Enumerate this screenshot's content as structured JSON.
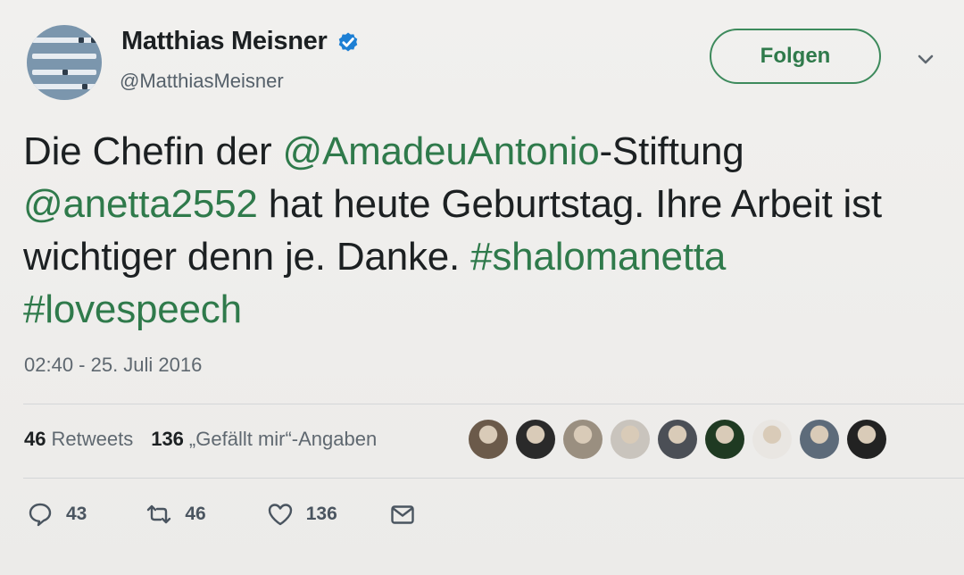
{
  "author": {
    "name": "Matthias Meisner",
    "handle": "@MatthiasMeisner",
    "verified": true
  },
  "follow_button": {
    "label": "Folgen"
  },
  "tweet": {
    "text_segments": [
      {
        "text": "Die Chefin der ",
        "link": false
      },
      {
        "text": "@AmadeuAntonio",
        "link": true
      },
      {
        "text": "-Stiftung ",
        "link": false
      },
      {
        "text": "@anetta2552",
        "link": true
      },
      {
        "text": " hat heute Geburtstag. Ihre Arbeit ist wichtiger denn je. Danke. ",
        "link": false
      },
      {
        "text": "#shalomanetta",
        "link": true
      },
      {
        "text": " ",
        "link": false
      },
      {
        "text": "#lovespeech",
        "link": true
      }
    ],
    "timestamp": "02:40 - 25. Juli 2016"
  },
  "stats": {
    "retweets_count": "46",
    "retweets_label": "Retweets",
    "likes_count": "136",
    "likes_label": "„Gefällt mir“-Angaben"
  },
  "likers": [
    {
      "name": "liker-avatar-1",
      "color": "#6b5a4a"
    },
    {
      "name": "liker-avatar-2",
      "color": "#2a2a2a"
    },
    {
      "name": "liker-avatar-3",
      "color": "#9a8f80"
    },
    {
      "name": "liker-avatar-4",
      "color": "#c9c4bd"
    },
    {
      "name": "liker-avatar-5",
      "color": "#4b4f56"
    },
    {
      "name": "liker-avatar-6",
      "color": "#1f3a22"
    },
    {
      "name": "liker-avatar-7",
      "color": "#e9e6e2"
    },
    {
      "name": "liker-avatar-8",
      "color": "#5d6b7a"
    },
    {
      "name": "liker-avatar-9",
      "color": "#222222"
    }
  ],
  "actions": {
    "reply_count": "43",
    "retweet_count": "46",
    "like_count": "136"
  },
  "colors": {
    "link": "#2f7a4b",
    "verified": "#1d7fd4"
  },
  "icons": {
    "verified": "verified-badge-icon",
    "caret": "chevron-down-icon",
    "reply": "reply-bubble-icon",
    "retweet": "retweet-arrows-icon",
    "like": "heart-icon",
    "dm": "envelope-icon"
  }
}
